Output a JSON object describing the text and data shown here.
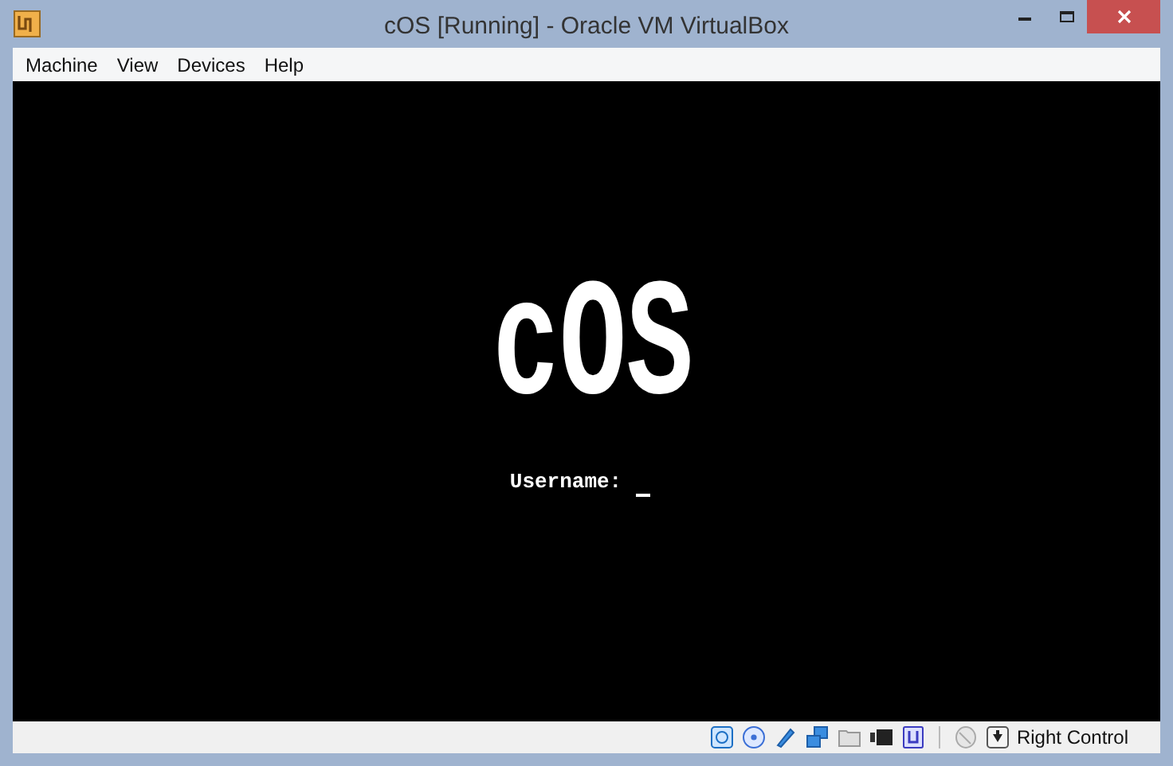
{
  "window": {
    "title": "cOS [Running] - Oracle VM VirtualBox"
  },
  "menu": [
    "Machine",
    "View",
    "Devices",
    "Help"
  ],
  "screen": {
    "logo": "cOS",
    "prompt": "Username:"
  },
  "status_bar": {
    "host_key": "Right Control"
  }
}
